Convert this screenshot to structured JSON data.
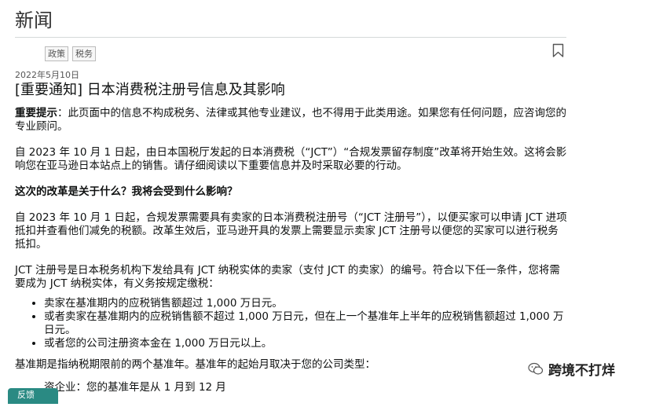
{
  "header": {
    "title": "新闻"
  },
  "tags": [
    "政策",
    "税务"
  ],
  "article": {
    "date": "2022年5月10日",
    "headline": "[重要通知] 日本消费税注册号信息及其影响",
    "notice_label": "重要提示",
    "notice_text": "：此页面中的信息不构成税务、法律或其他专业建议，也不得用于此类用途。如果您有任何问题，应咨询您的专业顾问。",
    "p1": "自 2023 年 10 月 1 日起，由日本国税厅发起的日本消费税（“JCT”）“合规发票留存制度”改革将开始生效。这将会影响您在亚马逊日本站点上的销售。请仔细阅读以下重要信息并及时采取必要的行动。",
    "section_heading": "这次的改革是关于什么？我将会受到什么影响？",
    "p2": "自 2023 年 10 月 1 日起，合规发票需要具有卖家的日本消费税注册号（“JCT 注册号”），以便买家可以申请 JCT 进项抵扣并查看他们减免的税额。改革生效后，亚马逊开具的发票上需要显示卖家 JCT 注册号以便您的买家可以进行税务抵扣。",
    "p3": "JCT 注册号是日本税务机构下发给具有 JCT 纳税实体的卖家（支付 JCT 的卖家）的编号。符合以下任一条件，您将需要成为 JCT 纳税实体，有义务按规定缴税：",
    "bullets": [
      "卖家在基准期内的应税销售额超过 1,000 万日元。",
      "或者卖家在基准期内的应税销售额不超过 1,000 万日元，但在上一个基准年上半年的应税销售额超过 1,000 万日元。",
      "或者您的公司注册资本金在 1,000 万日元以上。"
    ],
    "p4": "基准期是指纳税期限前的两个基准年。基准年的起始月取决于您的公司类型：",
    "p5_partial": "资企业：您的基准年是从 1 月到 12 月"
  },
  "watermark": {
    "text": "跨境不打烊"
  },
  "feedback": {
    "label": "反馈"
  },
  "colors": {
    "accent": "#2a8a83",
    "divider": "#d5d9d9"
  }
}
